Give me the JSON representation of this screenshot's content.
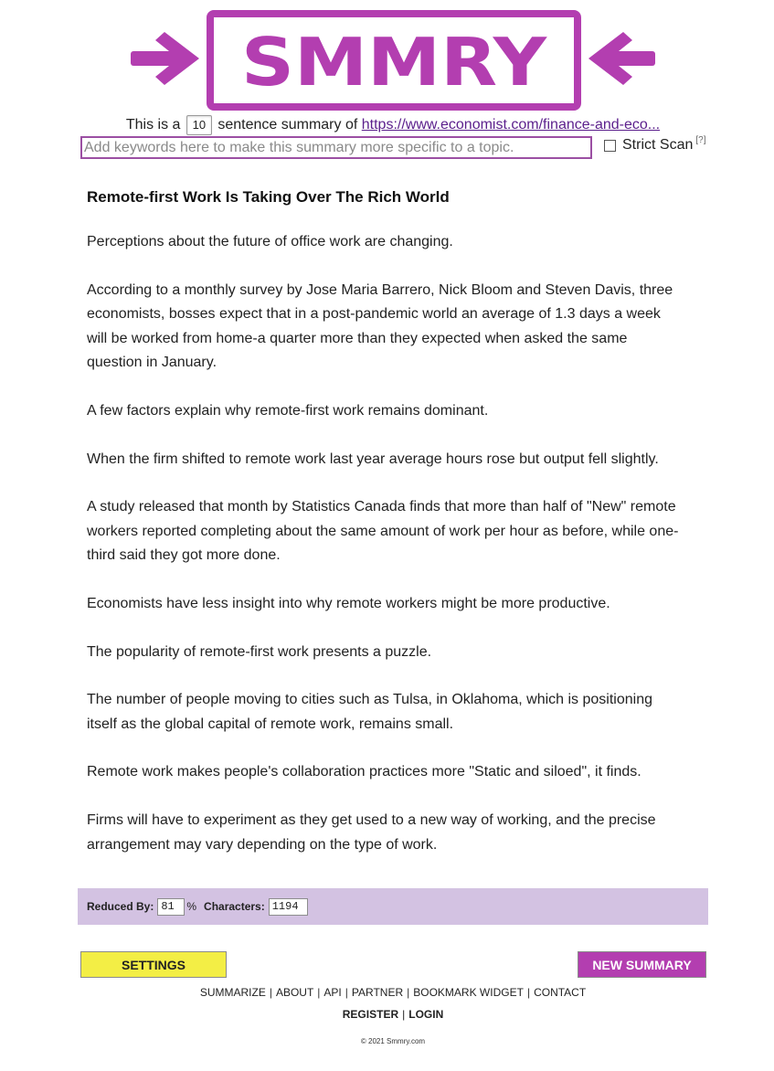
{
  "logo": {
    "text": "SMMRY",
    "color": "#b33eb0"
  },
  "summary_bar": {
    "prefix": "This is a",
    "sentence_count": "10",
    "middle": "sentence summary of",
    "source_url": "https://www.economist.com/finance-and-eco..."
  },
  "keywords": {
    "placeholder": "Add keywords here to make this summary more specific to a topic.",
    "value": ""
  },
  "strict_scan": {
    "label": "Strict Scan",
    "help": "[?]",
    "checked": false
  },
  "article": {
    "title": "Remote-first Work Is Taking Over The Rich World",
    "paragraphs": [
      "Perceptions about the future of office work are changing.",
      "According to a monthly survey by Jose Maria Barrero, Nick Bloom and Steven Davis, three economists, bosses expect that in a post-pandemic world an average of 1.3 days a week will be worked from home-a quarter more than they expected when asked the same question in January.",
      "A few factors explain why remote-first work remains dominant.",
      "When the firm shifted to remote work last year average hours rose but output fell slightly.",
      "A study released that month by Statistics Canada finds that more than half of \"New\" remote workers reported completing about the same amount of work per hour as before, while one-third said they got more done.",
      "Economists have less insight into why remote workers might be more productive.",
      "The popularity of remote-first work presents a puzzle.",
      "The number of people moving to cities such as Tulsa, in Oklahoma, which is positioning itself as the global capital of remote work, remains small.",
      "Remote work makes people's collaboration practices more \"Static and siloed\", it finds.",
      "Firms will have to experiment as they get used to a new way of working, and the precise arrangement may vary depending on the type of work."
    ]
  },
  "stats": {
    "reduced_label": "Reduced By:",
    "reduced_value": "81",
    "percent_sign": "%",
    "chars_label": "Characters:",
    "chars_value": "1194"
  },
  "buttons": {
    "settings": "SETTINGS",
    "new_summary": "NEW SUMMARY"
  },
  "footer": {
    "nav": [
      "SUMMARIZE",
      "ABOUT",
      "API",
      "PARTNER",
      "BOOKMARK WIDGET",
      "CONTACT"
    ],
    "separator": "|",
    "register": "REGISTER",
    "login": "LOGIN",
    "copyright": "© 2021  Smmry.com"
  },
  "colors": {
    "accent_purple": "#b33eb0",
    "stats_bg": "#d3c2e2",
    "settings_yellow": "#f3ee45",
    "link": "#5b1f8c"
  }
}
